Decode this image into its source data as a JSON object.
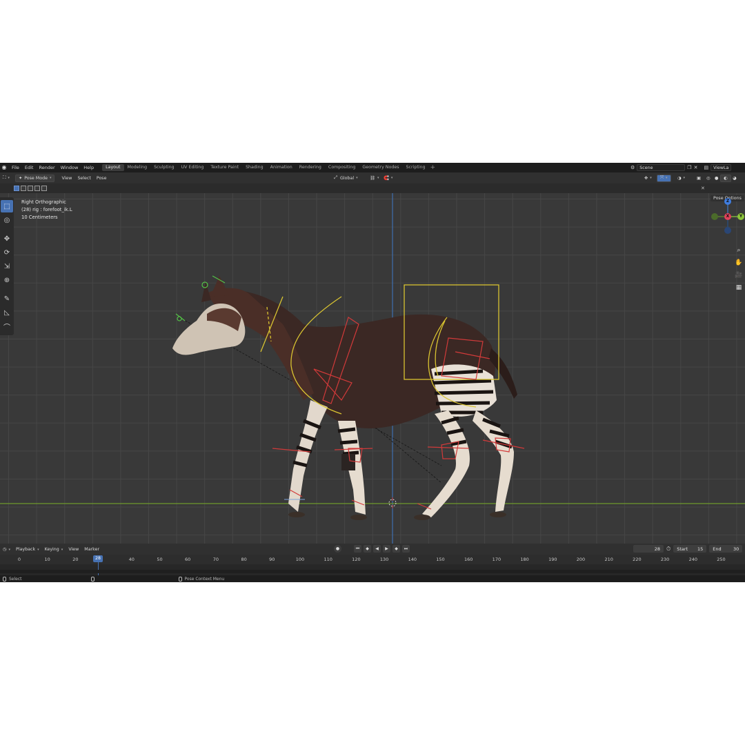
{
  "menu": [
    "File",
    "Edit",
    "Render",
    "Window",
    "Help"
  ],
  "workspaces": [
    {
      "label": "Layout",
      "active": true
    },
    {
      "label": "Modeling"
    },
    {
      "label": "Sculpting"
    },
    {
      "label": "UV Editing"
    },
    {
      "label": "Texture Paint"
    },
    {
      "label": "Shading"
    },
    {
      "label": "Animation"
    },
    {
      "label": "Rendering"
    },
    {
      "label": "Compositing"
    },
    {
      "label": "Geometry Nodes"
    },
    {
      "label": "Scripting"
    }
  ],
  "scene": {
    "name": "Scene",
    "view_layer": "ViewLa"
  },
  "header": {
    "mode": "Pose Mode",
    "view": "View",
    "select": "Select",
    "pose": "Pose",
    "orientation": "Global"
  },
  "viewport": {
    "view_name": "Right Orthographic",
    "active": "(28) rig : forefoot_ik.L",
    "scale": "10 Centimeters",
    "pose_options": "Pose Options",
    "gizmo": {
      "z": "Z",
      "x": "X",
      "y": "Y"
    }
  },
  "timeline": {
    "playback": "Playback",
    "keying": "Keying",
    "view": "View",
    "marker": "Marker",
    "current_frame": "28",
    "start_label": "Start",
    "start": "15",
    "end_label": "End",
    "end": "30",
    "ruler": [
      "0",
      "10",
      "20",
      "",
      "40",
      "50",
      "60",
      "70",
      "80",
      "90",
      "100",
      "110",
      "120",
      "130",
      "140",
      "150",
      "160",
      "170",
      "180",
      "190",
      "200",
      "210",
      "220",
      "230",
      "240",
      "250"
    ]
  },
  "status": {
    "left": "Select",
    "middle": "Pose Context Menu"
  },
  "colors": {
    "accent": "#4772b3",
    "bone_yellow": "#d9c431",
    "bone_red": "#d23a3a"
  }
}
